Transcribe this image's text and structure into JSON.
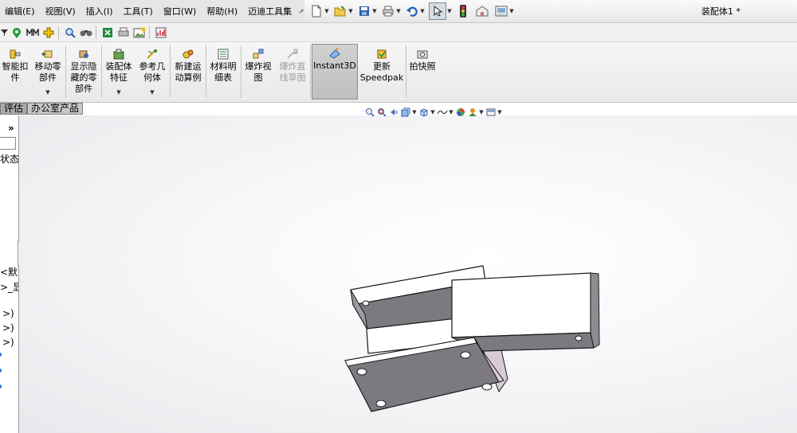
{
  "menubar": {
    "items": [
      "编辑(E)",
      "视图(V)",
      "插入(I)",
      "工具(T)",
      "窗口(W)",
      "帮助(H)",
      "迈迪工具集"
    ],
    "document_title": "装配体1 *"
  },
  "quick_access": {
    "icons": [
      "new-document-icon",
      "open-folder-icon",
      "save-icon",
      "print-icon",
      "undo-icon",
      "select-arrow-icon",
      "traffic-light-icon",
      "options-icon",
      "view-panel-icon"
    ]
  },
  "iconrow": {
    "icons": [
      "funnel-icon",
      "green-location-icon",
      "mates-icon",
      "plus-icon",
      "search-icon",
      "binoculars-icon",
      "excel-icon",
      "printer-icon",
      "image-icon",
      "chart-icon"
    ]
  },
  "ribbon": {
    "commands": [
      {
        "label": "智能扣\n件",
        "icon": "smart-fastener-icon",
        "disabled": false,
        "dropdown": false
      },
      {
        "label": "移动零\n部件",
        "icon": "move-component-icon",
        "disabled": false,
        "dropdown": true
      },
      {
        "label": "显示隐\n藏的零\n部件",
        "icon": "show-hidden-icon",
        "disabled": false,
        "dropdown": false
      },
      {
        "label": "装配体\n特征",
        "icon": "assembly-feature-icon",
        "disabled": false,
        "dropdown": true
      },
      {
        "label": "参考几\n何体",
        "icon": "reference-geometry-icon",
        "disabled": false,
        "dropdown": true
      },
      {
        "label": "新建运\n动算例",
        "icon": "motion-study-icon",
        "disabled": false,
        "dropdown": false
      },
      {
        "label": "材料明\n细表",
        "icon": "bom-icon",
        "disabled": false,
        "dropdown": false
      },
      {
        "label": "爆炸视\n图",
        "icon": "exploded-view-icon",
        "disabled": false,
        "dropdown": false
      },
      {
        "label": "爆炸直\n线草图",
        "icon": "explode-line-sketch-icon",
        "disabled": true,
        "dropdown": false
      },
      {
        "label": "Instant3D",
        "icon": "instant3d-icon",
        "disabled": false,
        "dropdown": false,
        "active": true
      },
      {
        "label": "更新\nSpeedpak",
        "icon": "speedpak-icon",
        "disabled": false,
        "dropdown": false
      },
      {
        "label": "拍快照",
        "icon": "snapshot-icon",
        "disabled": false,
        "dropdown": false
      }
    ]
  },
  "tabs": [
    {
      "label": "评估",
      "active": false
    },
    {
      "label": "办公室产品",
      "active": true
    }
  ],
  "left_panel": {
    "collapse_glyph": "»",
    "status_text": "状态",
    "default_text": "<默",
    "display_text": ">_显",
    "rows": [
      ">)",
      ">)",
      ">)"
    ]
  },
  "heads_up_toolbar": {
    "icons": [
      "zoom-to-fit-icon",
      "zoom-area-icon",
      "previous-view-icon",
      "section-view-icon",
      "view-orientation-icon",
      "display-style-icon",
      "hide-show-items-icon",
      "edit-appearance-icon",
      "apply-scene-icon",
      "view-settings-icon"
    ]
  },
  "colors": {
    "part_top": "#ffffff",
    "part_side": "#7c7a80",
    "part_edge": "#1a1a1a",
    "part_pink": "#d9cbd6",
    "active_command": "#c4c4c4"
  }
}
